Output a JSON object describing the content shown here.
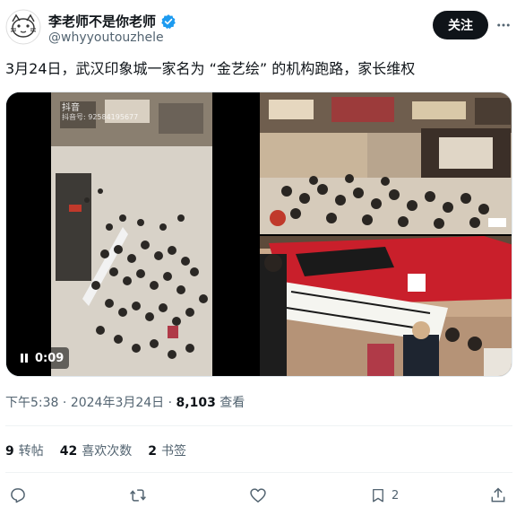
{
  "author": {
    "display_name": "李老师不是你老师",
    "handle": "@whyyoutouzhele",
    "verified": true
  },
  "follow_button": {
    "label": "关注"
  },
  "tweet": {
    "text": "3月24日，武汉印象城一家名为 “金艺绘” 的机构跑路，家长维权"
  },
  "media": {
    "video_duration": "0:09",
    "video_watermark": "抖音",
    "video_watermark_id": "抖音号: 92584195677"
  },
  "meta": {
    "time": "下午5:38",
    "separator": " · ",
    "date": "2024年3月24日",
    "views_count": "8,103",
    "views_label": " 查看"
  },
  "stats": {
    "retweets_count": "9",
    "retweets_label": "转帖",
    "likes_count": "42",
    "likes_label": "喜欢次数",
    "bookmarks_count": "2",
    "bookmarks_label": "书签"
  },
  "actions": {
    "reply_icon": "reply-icon",
    "retweet_icon": "retweet-icon",
    "like_icon": "heart-icon",
    "bookmark_icon": "bookmark-icon",
    "bookmark_count": "2",
    "share_icon": "share-icon"
  },
  "colors": {
    "text_primary": "#0f1419",
    "text_secondary": "#536471",
    "verified_blue": "#1d9bf0",
    "follow_bg": "#0f1419",
    "divider": "#eff3f4"
  }
}
